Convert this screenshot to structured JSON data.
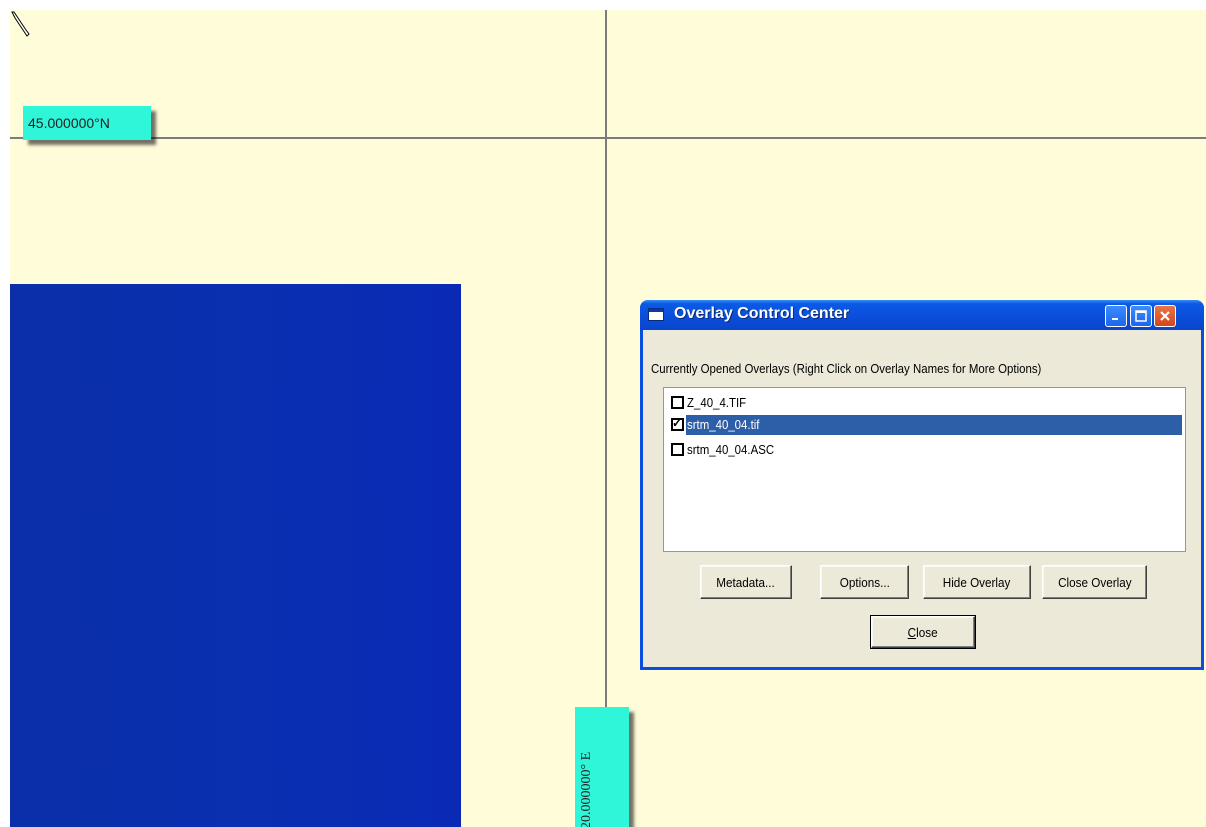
{
  "map": {
    "lat_label": "45.000000°N",
    "lon_label": "20.000000° E",
    "colors": {
      "background": "#fffcd9",
      "raster": "#0b2fa8",
      "label_bg": "#2ff5d9",
      "gridline": "#7c7c7c"
    }
  },
  "dialog": {
    "title": "Overlay Control Center",
    "caption": "Currently Opened Overlays (Right Click on Overlay Names for More Options)",
    "overlays": [
      {
        "name": "Z_40_4.TIF",
        "checked": false,
        "selected": false
      },
      {
        "name": "srtm_40_04.tif",
        "checked": true,
        "selected": true
      },
      {
        "name": "srtm_40_04.ASC",
        "checked": false,
        "selected": false
      }
    ],
    "buttons": {
      "metadata": "Metadata...",
      "options": "Options...",
      "hide_overlay": "Hide Overlay",
      "close_overlay": "Close Overlay",
      "close": "Close"
    },
    "colors": {
      "titlebar": "#0a4ed9",
      "face": "#ece9d8",
      "selection": "#2d5fa8"
    }
  }
}
